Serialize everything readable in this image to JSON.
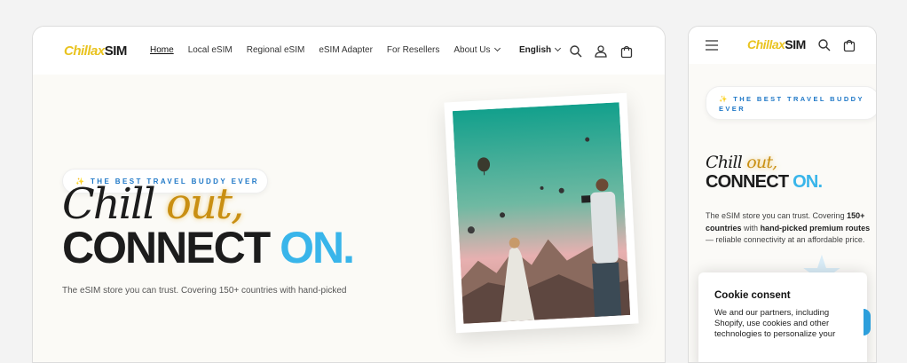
{
  "brand": {
    "logo_chillax": "Chillax",
    "logo_sim": "SIM"
  },
  "desktop": {
    "nav": [
      "Home",
      "Local eSIM",
      "Regional eSIM",
      "eSIM Adapter",
      "For Resellers",
      "About Us"
    ],
    "language": "English",
    "hero": {
      "tagline": "✨ THE BEST TRAVEL BUDDY EVER",
      "chill": "Chill",
      "out": "out,",
      "connect": "CONNECT",
      "on": "ON.",
      "description": "The eSIM store you can trust. Covering 150+ countries with hand-picked"
    }
  },
  "mobile": {
    "hero": {
      "tagline": "✨ THE BEST TRAVEL BUDDY EVER",
      "chill": "Chill",
      "out": "out,",
      "connect": "CONNECT",
      "on": "ON.",
      "desc_1": "The eSIM store you can trust. Covering",
      "desc_bold_1": "150+ countries",
      "desc_2": "with",
      "desc_bold_2": "hand-picked premium routes",
      "desc_3": "— reliable connectivity at an affordable price."
    },
    "cookie": {
      "title": "Cookie consent",
      "text": "We and our partners, including Shopify, use cookies and other technologies to personalize your"
    }
  },
  "colors": {
    "brand_yellow": "#e9c31f",
    "accent_blue": "#39b5ea",
    "gold": "#c98f12",
    "tagline_blue": "#1f78c7"
  }
}
